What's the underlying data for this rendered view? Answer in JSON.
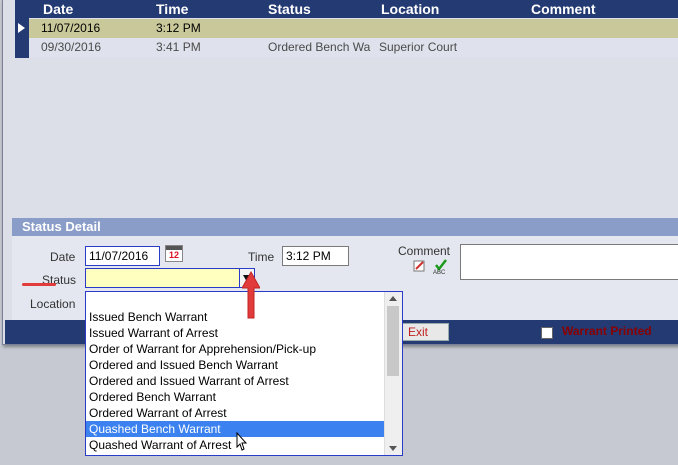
{
  "grid": {
    "headers": [
      "Date",
      "Time",
      "Status",
      "Location",
      "Comment"
    ],
    "rows": [
      {
        "date": "11/07/2016",
        "time": "3:12 PM",
        "status": "",
        "location": "",
        "comment": ""
      },
      {
        "date": "09/30/2016",
        "time": "3:41 PM",
        "status": "Ordered Bench Wa",
        "location": "Superior Court",
        "comment": ""
      }
    ]
  },
  "detail": {
    "title": "Status Detail",
    "date_label": "Date",
    "date_value": "11/07/2016",
    "calendar_day": "12",
    "time_label": "Time",
    "time_value": "3:12 PM",
    "comment_label": "Comment",
    "status_label": "Status",
    "status_value": "",
    "location_label": "Location"
  },
  "footer": {
    "exit_label": "Exit",
    "warrant_printed_label": "Warrant Printed"
  },
  "dropdown": {
    "options": [
      "Issued Bench Warrant",
      "Issued Warrant of Arrest",
      "Order of Warrant for Apprehension/Pick-up",
      "Ordered and Issued Bench Warrant",
      "Ordered and Issued Warrant of Arrest",
      "Ordered Bench Warrant",
      "Ordered Warrant of Arrest",
      "Quashed Bench Warrant",
      "Quashed Warrant of Arrest"
    ],
    "highlighted": "Quashed Bench Warrant"
  },
  "colors": {
    "header_bg": "#243a73",
    "selected_row": "#c9c89a",
    "highlight": "#3b82f0",
    "annotation_red": "#e23b3b"
  }
}
